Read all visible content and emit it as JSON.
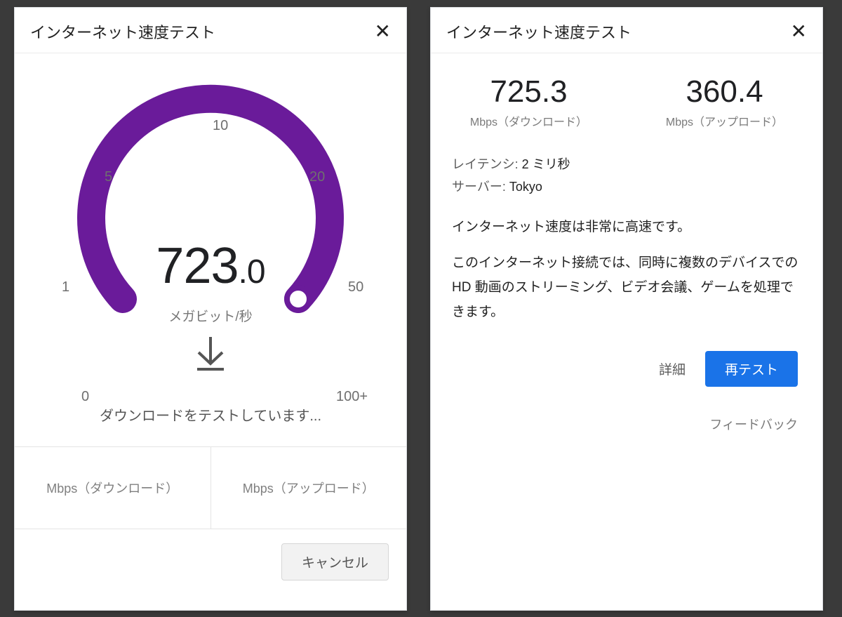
{
  "chart_data": {
    "type": "gauge",
    "ticks": [
      "0",
      "1",
      "5",
      "10",
      "20",
      "50",
      "100+"
    ],
    "value": 723.0,
    "unit": "メガビット/秒",
    "range_note": "non-linear; needle beyond max (100+)",
    "arc_color": "#6a1b9a"
  },
  "left": {
    "title": "インターネット速度テスト",
    "close": "✕",
    "speed_int": "723",
    "speed_dec": ".0",
    "unit": "メガビット/秒",
    "status": "ダウンロードをテストしています...",
    "download_label": "Mbps（ダウンロード）",
    "upload_label": "Mbps（アップロード）",
    "cancel": "キャンセル",
    "ticks": {
      "t0": "0",
      "t1": "1",
      "t5": "5",
      "t10": "10",
      "t20": "20",
      "t50": "50",
      "t100": "100+"
    }
  },
  "right": {
    "title": "インターネット速度テスト",
    "close": "✕",
    "download_value": "725.3",
    "download_label": "Mbps（ダウンロード）",
    "upload_value": "360.4",
    "upload_label": "Mbps（アップロード）",
    "latency_label": "レイテンシ: ",
    "latency_value": "2 ミリ秒",
    "server_label": "サーバー: ",
    "server_value": "Tokyo",
    "verdict": "インターネット速度は非常に高速です。",
    "desc": "このインターネット接続では、同時に複数のデバイスでの HD 動画のストリーミング、ビデオ会議、ゲームを処理できます。",
    "details": "詳細",
    "retest": "再テスト",
    "feedback": "フィードバック"
  }
}
